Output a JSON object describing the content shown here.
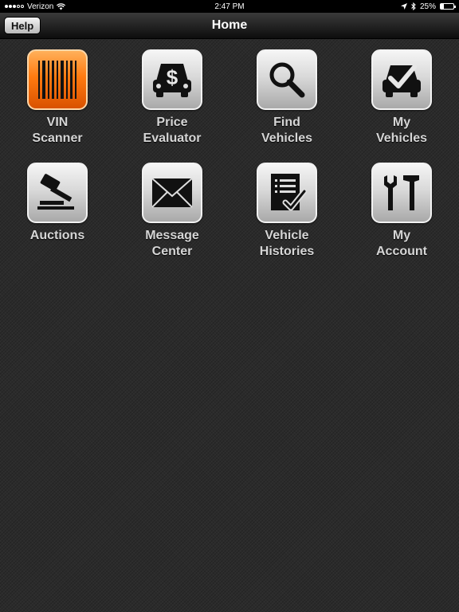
{
  "status_bar": {
    "carrier": "Verizon",
    "time": "2:47 PM",
    "battery_percent": "25%",
    "battery_level": 0.25,
    "icons": [
      "signal-dots-icon",
      "wifi-icon",
      "location-arrow-icon",
      "bluetooth-icon",
      "battery-icon"
    ]
  },
  "nav": {
    "title": "Home",
    "help_label": "Help"
  },
  "tiles": [
    {
      "line1": "VIN",
      "line2": "Scanner",
      "icon": "barcode-icon",
      "accent": "#ff7a10"
    },
    {
      "line1": "Price",
      "line2": "Evaluator",
      "icon": "price-car-icon"
    },
    {
      "line1": "Find",
      "line2": "Vehicles",
      "icon": "magnifier-icon"
    },
    {
      "line1": "My",
      "line2": "Vehicles",
      "icon": "car-check-icon"
    },
    {
      "line1": "Auctions",
      "line2": "",
      "icon": "gavel-icon"
    },
    {
      "line1": "Message",
      "line2": "Center",
      "icon": "envelope-icon"
    },
    {
      "line1": "Vehicle",
      "line2": "Histories",
      "icon": "checklist-icon"
    },
    {
      "line1": "My",
      "line2": "Account",
      "icon": "tools-icon"
    }
  ]
}
